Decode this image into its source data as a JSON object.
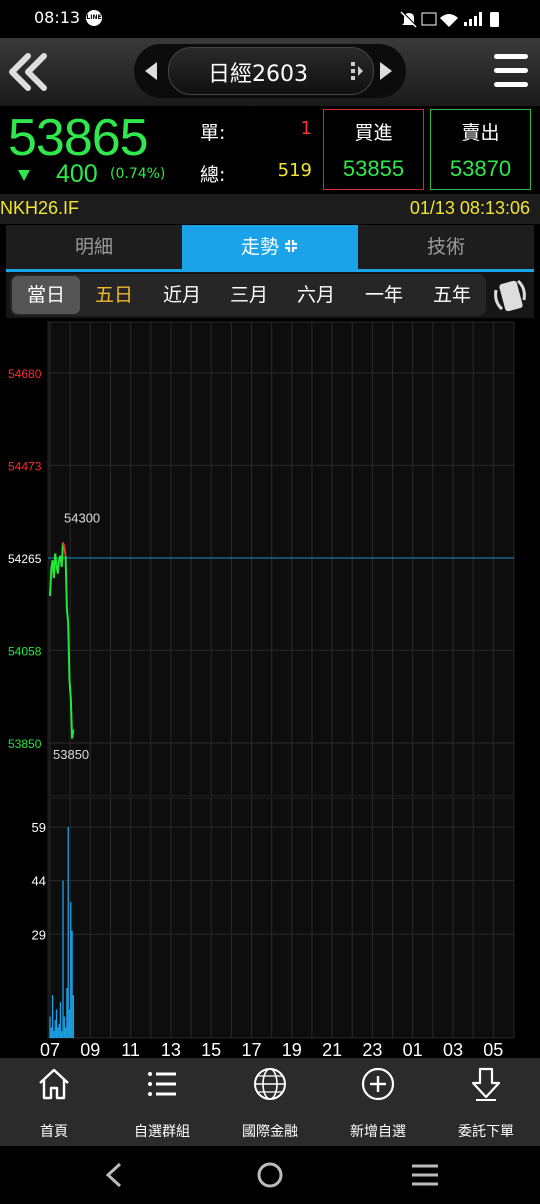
{
  "status_bar": {
    "time": "08:13",
    "line_badge": "LINE"
  },
  "header": {
    "title": "日經2603"
  },
  "quote": {
    "price": "53865",
    "change": "400",
    "change_pct": "(0.74%)",
    "single_label": "單:",
    "single_value": "1",
    "total_label": "總:",
    "total_value": "519",
    "buy_label": "買進",
    "buy_price": "53855",
    "sell_label": "賣出",
    "sell_price": "53870"
  },
  "info": {
    "code": "NKH26.IF",
    "datetime": "01/13 08:13:06"
  },
  "tabs": [
    {
      "label": "明細"
    },
    {
      "label": "走勢"
    },
    {
      "label": "技術"
    }
  ],
  "periods": [
    {
      "label": "當日"
    },
    {
      "label": "五日"
    },
    {
      "label": "近月"
    },
    {
      "label": "三月"
    },
    {
      "label": "六月"
    },
    {
      "label": "一年"
    },
    {
      "label": "五年"
    }
  ],
  "chart_data": [
    {
      "type": "line",
      "y_tick_labels": [
        "54680",
        "54473",
        "54265",
        "54058",
        "53850"
      ],
      "ylim": [
        53850,
        54680
      ],
      "reference_price": 54265,
      "annotations": {
        "high": "54300",
        "low": "53850"
      },
      "x_tick_labels": [
        "07",
        "09",
        "11",
        "13",
        "15",
        "17",
        "19",
        "21",
        "23",
        "01",
        "03",
        "05"
      ],
      "series": [
        {
          "values": [
            54180,
            54240,
            54260,
            54220,
            54275,
            54250,
            54230,
            54262,
            54270,
            54245,
            54300,
            54290,
            54270,
            54150,
            54120,
            53990,
            53950,
            53860,
            53880
          ]
        }
      ],
      "colors": {
        "up": "#ff2a2a",
        "down": "#22e83a",
        "reference": "#1a8fd0"
      }
    },
    {
      "type": "bar",
      "y_tick_labels": [
        "59",
        "44",
        "29"
      ],
      "ylim": [
        0,
        66
      ],
      "values": [
        6,
        3,
        12,
        2,
        5,
        8,
        3,
        4,
        10,
        2,
        44,
        6,
        3,
        14,
        59,
        8,
        38,
        30,
        12
      ],
      "color": "#1aa3e8"
    }
  ],
  "bottom_nav": [
    {
      "label": "首頁",
      "icon": "home-icon"
    },
    {
      "label": "自選群組",
      "icon": "list-icon"
    },
    {
      "label": "國際金融",
      "icon": "globe-icon"
    },
    {
      "label": "新增自選",
      "icon": "add-circle-icon"
    },
    {
      "label": "委託下單",
      "icon": "order-arrow-icon"
    }
  ]
}
